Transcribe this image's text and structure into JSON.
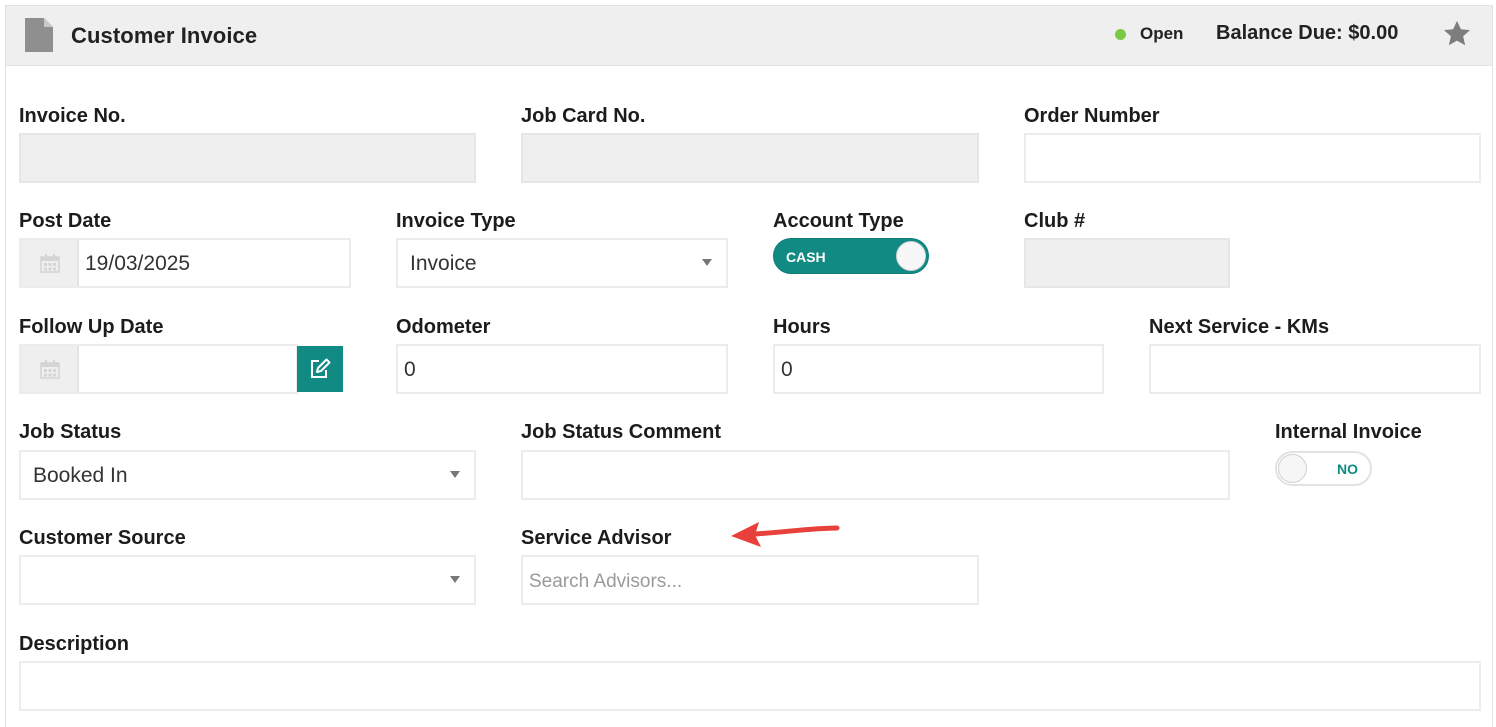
{
  "header": {
    "title": "Customer Invoice",
    "status": "Open",
    "balance": "Balance Due: $0.00",
    "icons": {
      "document": "document-icon",
      "star": "star-icon"
    },
    "status_color": "#7ac943"
  },
  "form": {
    "invoice_no": {
      "label": "Invoice No.",
      "value": ""
    },
    "job_card_no": {
      "label": "Job Card No.",
      "value": ""
    },
    "order_number": {
      "label": "Order Number",
      "value": ""
    },
    "post_date": {
      "label": "Post Date",
      "value": "19/03/2025"
    },
    "invoice_type": {
      "label": "Invoice Type",
      "value": "Invoice"
    },
    "account_type": {
      "label": "Account Type",
      "toggle_label": "CASH"
    },
    "club_no": {
      "label": "Club #",
      "value": ""
    },
    "follow_up_date": {
      "label": "Follow Up Date",
      "value": ""
    },
    "odometer": {
      "label": "Odometer",
      "value": "0"
    },
    "hours": {
      "label": "Hours",
      "value": "0"
    },
    "next_service": {
      "label": "Next Service - KMs",
      "value": ""
    },
    "job_status": {
      "label": "Job Status",
      "value": "Booked In"
    },
    "job_status_comment": {
      "label": "Job Status Comment",
      "value": ""
    },
    "internal_invoice": {
      "label": "Internal Invoice",
      "toggle_label": "NO"
    },
    "customer_source": {
      "label": "Customer Source",
      "value": ""
    },
    "service_advisor": {
      "label": "Service Advisor",
      "placeholder": "Search Advisors..."
    },
    "description": {
      "label": "Description",
      "value": ""
    }
  },
  "colors": {
    "accent": "#118a84",
    "arrow": "#e8413c"
  }
}
